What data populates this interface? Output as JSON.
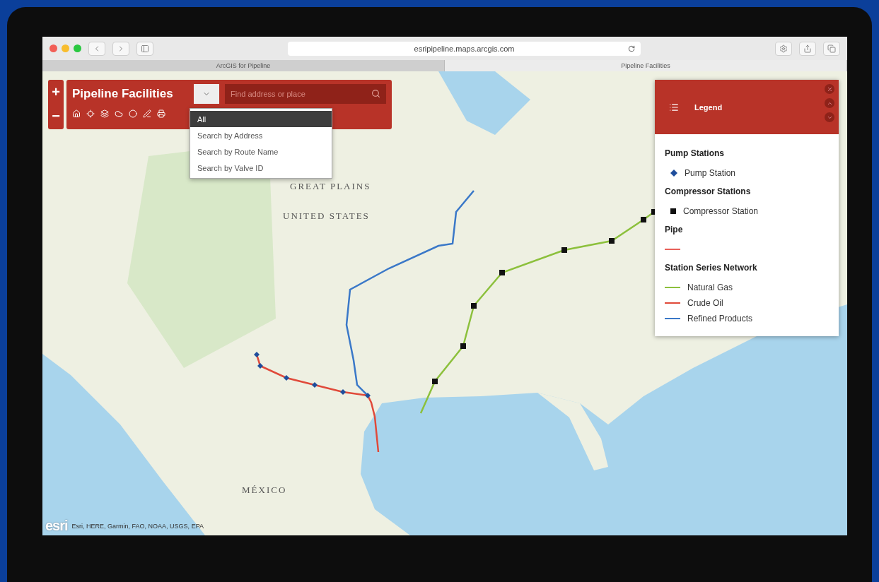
{
  "browser": {
    "url": "esripipeline.maps.arcgis.com",
    "tabs": [
      {
        "label": "ArcGIS for Pipeline",
        "selected": false
      },
      {
        "label": "Pipeline Facilities",
        "selected": true
      }
    ]
  },
  "app": {
    "zoom_in": "+",
    "zoom_out": "−",
    "title": "Pipeline Facilities",
    "search": {
      "placeholder": "Find address or place"
    },
    "search_options": [
      {
        "label": "All",
        "selected": true
      },
      {
        "label": "Search by Address",
        "selected": false
      },
      {
        "label": "Search by Route Name",
        "selected": false
      },
      {
        "label": "Search by Valve ID",
        "selected": false
      }
    ]
  },
  "legend": {
    "title": "Legend",
    "sections": [
      {
        "heading": "Pump Stations",
        "items": [
          {
            "kind": "diamond",
            "label": "Pump Station",
            "color": "#1f4e9c"
          }
        ]
      },
      {
        "heading": "Compressor Stations",
        "items": [
          {
            "kind": "square",
            "label": "Compressor Station",
            "color": "#111111"
          }
        ]
      },
      {
        "heading": "Pipe",
        "items": [
          {
            "kind": "line",
            "color": "#e8605a"
          }
        ]
      },
      {
        "heading": "Station Series Network",
        "items": [
          {
            "kind": "line",
            "label": "Natural Gas",
            "color": "#8cc03c"
          },
          {
            "kind": "line",
            "label": "Crude Oil",
            "color": "#e04a3a"
          },
          {
            "kind": "line",
            "label": "Refined Products",
            "color": "#3a78c8"
          }
        ]
      }
    ]
  },
  "map": {
    "labels": [
      "GREAT PLAINS",
      "UNITED STATES",
      "MÉXICO"
    ],
    "logo": "esri",
    "attribution": "Esri, HERE, Garmin, FAO, NOAA, USGS, EPA"
  }
}
